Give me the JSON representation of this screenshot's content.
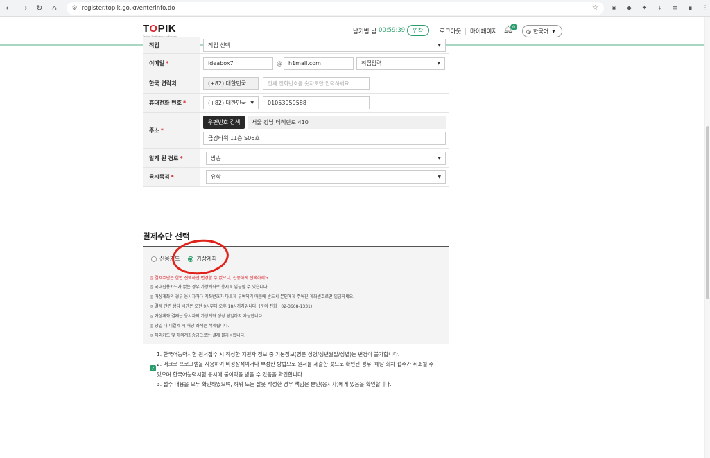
{
  "browser": {
    "url": "register.topik.go.kr/enterinfo.do"
  },
  "header": {
    "logo_text_t": "T",
    "logo_text_o": "O",
    "logo_text_pik": "PIK",
    "logo_sub": "Test of Proficiency in Korean",
    "user_name": "남기범 님",
    "timer": "00:59:39",
    "extend_label": "연장",
    "logout_label": "로그아웃",
    "mypage_label": "마이페이지",
    "notification_count": "0",
    "language_label": "한국어"
  },
  "form": {
    "job": {
      "label": "직업",
      "value": "직업 선택"
    },
    "email": {
      "label": "이메일",
      "id_value": "ideabox7",
      "at": "@",
      "domain_value": "h1mall.com",
      "domain_select": "직접입력"
    },
    "korea_contact": {
      "label": "한국 연락처",
      "country_code": "(+82) 대한민국",
      "placeholder": "전체 전화번호를 숫자로만 입력하세요."
    },
    "mobile": {
      "label": "휴대전화 번호",
      "country_code": "(+82) 대한민국",
      "value": "01053959588"
    },
    "address": {
      "label": "주소",
      "search_button": "우편번호 검색",
      "address1": "서울 강남 테헤란로 410",
      "address2": "금강타워 11층 S06호"
    },
    "referral": {
      "label": "알게 된 경로",
      "value": "방송"
    },
    "purpose": {
      "label": "응시목적",
      "value": "유학"
    },
    "required_mark": "*"
  },
  "payment": {
    "title": "결제수단 선택",
    "options": [
      {
        "label": "신용카드",
        "selected": false
      },
      {
        "label": "가상계좌",
        "selected": true
      }
    ],
    "notices": [
      "◎ 결제수단은 한번 선택하면 변경할 수 없으니, 신중하게 선택하세요.",
      "◎ 국내신용카드가 없는 경우 가상계좌로 응시료 입금할 수 있습니다.",
      "◎ 가상계좌의 경우 응시자마다 계좌번호가 다르게 부여되기 때문에 반드시 본인에게 주어진 계좌번호로만 입금하세요.",
      "◎ 결제 관련 상담 시간은 오전 9시부터 오후 18시까지입니다. (문의 전화 : 02-3668-1331)",
      "◎ 가상계좌 결제는 응시자의 가상계좌 생성 당일까지 가능합니다.",
      "◎ 당일 내 미결제 시 해당 좌석은 삭제됩니다.",
      "◎ 해외카드 및 해외계좌송금으로는 결제 불가능합니다."
    ],
    "accent_color": "#2b9c6c",
    "warning_color": "#d8232a"
  },
  "agreement": {
    "checked": true,
    "lines": [
      "1. 한국어능력시험 원서접수 시 작성한 지원자 정보 중 기본정보(영문 성명/생년월일/성별)는 변경이 불가합니다.",
      "2. 매크로 프로그램을 사용하여 비정상적이거나 부정한 방법으로 원서를 제출한 것으로 확인된 경우, 해당 회차 접수가 취소될 수",
      "있으며 한국어능력시험 응시에 불이익을 받을 수 있음을 확인합니다.",
      "3. 접수 내용을 모두 확인하였으며, 허위 또는 잘못 작성한 경우 책임은 본인(응시자)에게 있음을 확인합니다."
    ]
  }
}
